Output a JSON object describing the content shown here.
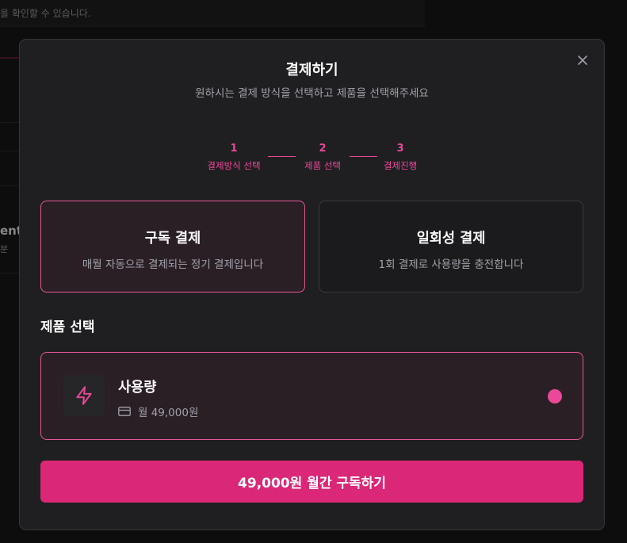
{
  "background": {
    "topbar_text": "을 확인할 수 있습니다.",
    "fragment_big": "ent",
    "fragment_small": "분"
  },
  "modal": {
    "title": "결제하기",
    "subtitle": "원하시는 결제 방식을 선택하고 제품을 선택해주세요",
    "close_icon": "close-icon"
  },
  "steps": [
    {
      "number": "1",
      "label": "결제방식 선택"
    },
    {
      "number": "2",
      "label": "제품 선택"
    },
    {
      "number": "3",
      "label": "결제진행"
    }
  ],
  "payment_types": {
    "subscription": {
      "title": "구독 결제",
      "description": "매월 자동으로 결제되는 정기 결제입니다",
      "selected": true
    },
    "one_time": {
      "title": "일회성 결제",
      "description": "1회 결제로 사용량을 충전합니다",
      "selected": false
    }
  },
  "product_section": {
    "title": "제품 선택",
    "product": {
      "icon": "lightning-icon",
      "name": "사용량",
      "price_icon": "card-icon",
      "price": "월 49,000원",
      "selected": true
    }
  },
  "cta": {
    "label": "49,000원 월간 구독하기"
  },
  "colors": {
    "accent": "#ec4899",
    "button": "#db2777",
    "modal_bg": "#1f1f21",
    "selected_bg": "#2b1f26"
  }
}
